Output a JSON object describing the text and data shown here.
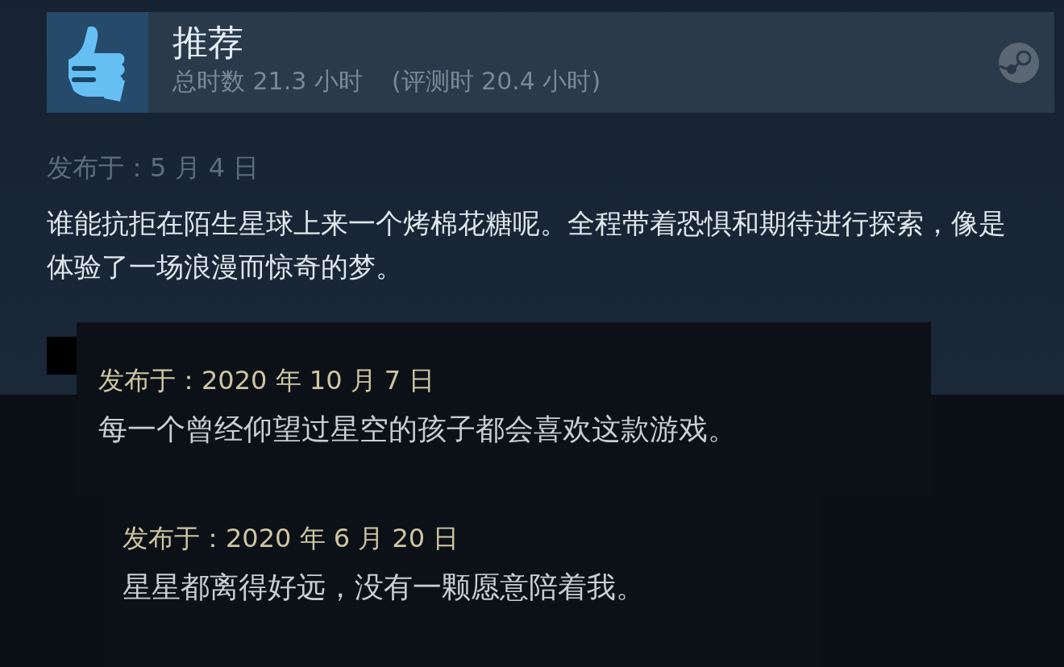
{
  "review": {
    "verdict": "推荐",
    "total_hours": "总时数 21.3 小时",
    "review_hours": "(评测时 20.4 小时)",
    "posted": "发布于：5 月 4 日",
    "text": "谁能抗拒在陌生星球上来一个烤棉花糖呢。全程带着恐惧和期待进行探索，像是体验了一场浪漫而惊奇的梦。"
  },
  "overlay_reviews": [
    {
      "posted": "发布于：2020 年 10 月 7 日",
      "text": "每一个曾经仰望过星空的孩子都会喜欢这款游戏。"
    },
    {
      "posted": "发布于：2020 年 6 月 20 日",
      "text": "星星都离得好远，没有一颗愿意陪着我。"
    }
  ]
}
